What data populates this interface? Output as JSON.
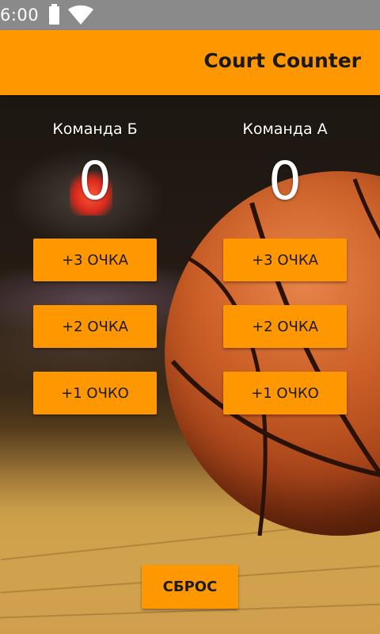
{
  "status_bar": {
    "time": "6:00",
    "icons": [
      "battery-icon",
      "wifi-icon"
    ]
  },
  "app_bar": {
    "title": "Court Counter",
    "color": "#ff9800"
  },
  "teams": [
    {
      "name": "Команда Б",
      "score": "0",
      "buttons": [
        "+3 ОЧКА",
        "+2 ОЧКА",
        "+1 ОЧКО"
      ]
    },
    {
      "name": "Команда А",
      "score": "0",
      "buttons": [
        "+3 ОЧКА",
        "+2 ОЧКА",
        "+1 ОЧКО"
      ]
    }
  ],
  "reset_label": "СБРОС",
  "colors": {
    "accent": "#ff9800",
    "text_dark": "#1a1a1a",
    "text_light": "#ffffff"
  }
}
